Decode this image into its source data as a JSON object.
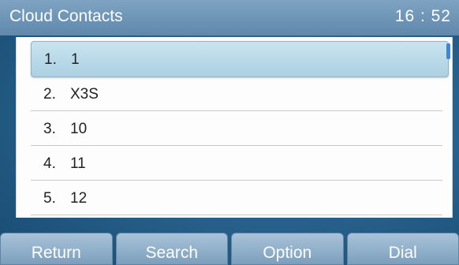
{
  "header": {
    "title": "Cloud Contacts",
    "time": "16 : 52"
  },
  "contacts": [
    {
      "num": "1.",
      "name": "1"
    },
    {
      "num": "2.",
      "name": "X3S"
    },
    {
      "num": "3.",
      "name": "10"
    },
    {
      "num": "4.",
      "name": "11"
    },
    {
      "num": "5.",
      "name": "12"
    }
  ],
  "softkeys": [
    "Return",
    "Search",
    "Option",
    "Dial"
  ]
}
